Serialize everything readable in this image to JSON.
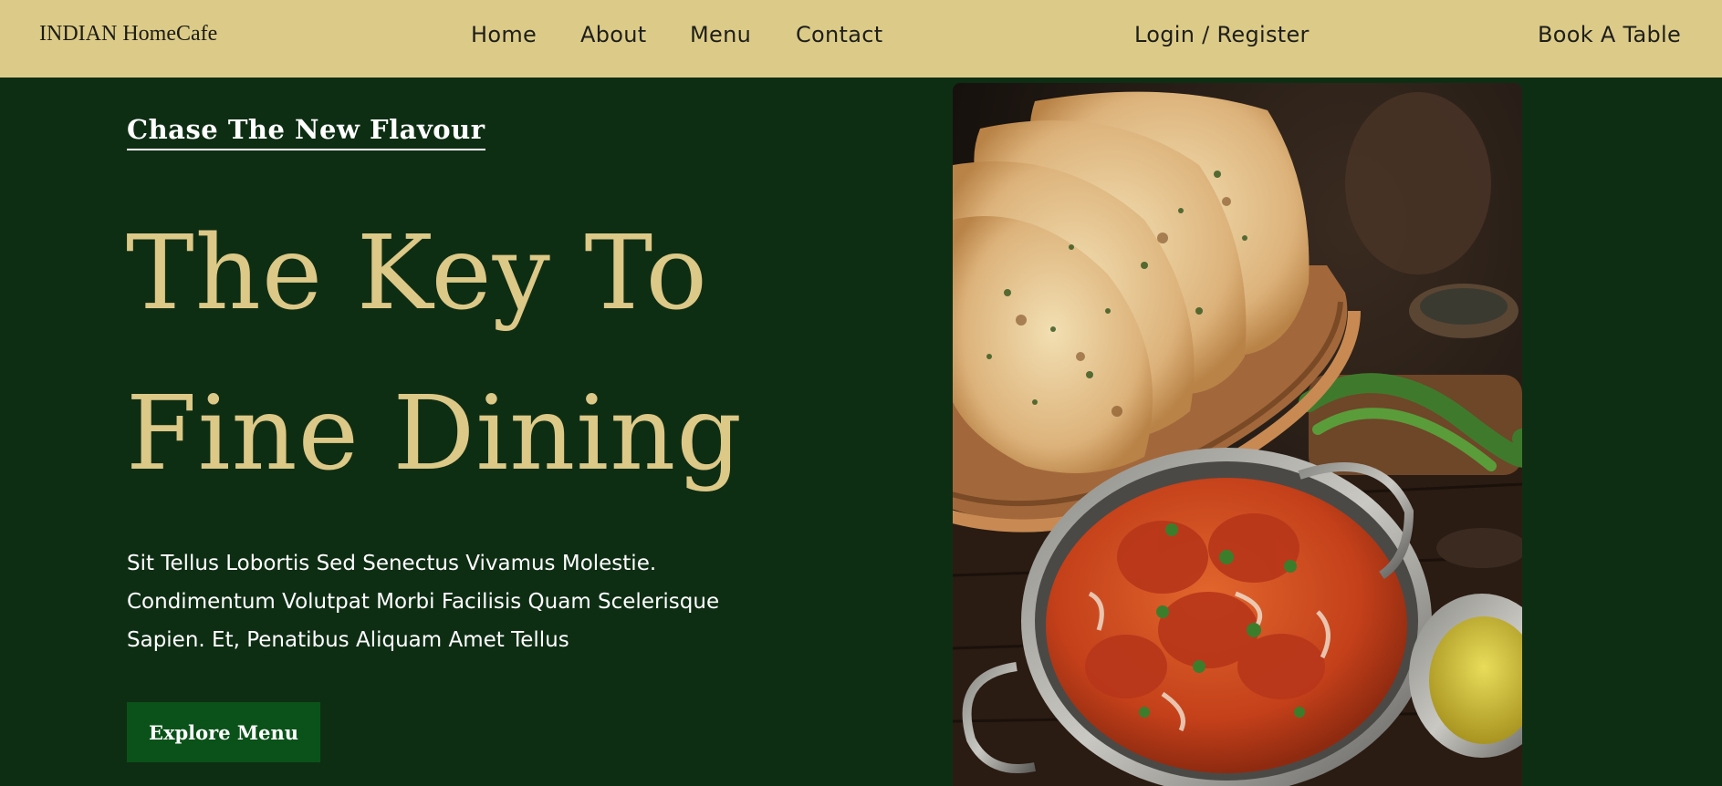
{
  "header": {
    "brand": "INDIAN HomeCafe",
    "nav": [
      {
        "label": "Home"
      },
      {
        "label": "About"
      },
      {
        "label": "Menu"
      },
      {
        "label": "Contact"
      }
    ],
    "login_label": "Login / Register",
    "book_label": "Book A Table"
  },
  "hero": {
    "eyebrow": "Chase The New Flavour",
    "title_line1": "The Key To",
    "title_line2": "Fine Dining",
    "description": "Sit Tellus Lobortis Sed Senectus Vivamus Molestie. Condimentum Volutpat Morbi Facilisis Quam Scelerisque Sapien. Et, Penatibus Aliquam Amet Tellus",
    "cta_label": "Explore Menu",
    "image_subject": "naan-bread-basket-and-butter-chicken-curry"
  },
  "colors": {
    "header_bg": "#dccb88",
    "page_bg": "#0e2e14",
    "title_gold": "#dcc887",
    "button_green": "#0a5219"
  }
}
